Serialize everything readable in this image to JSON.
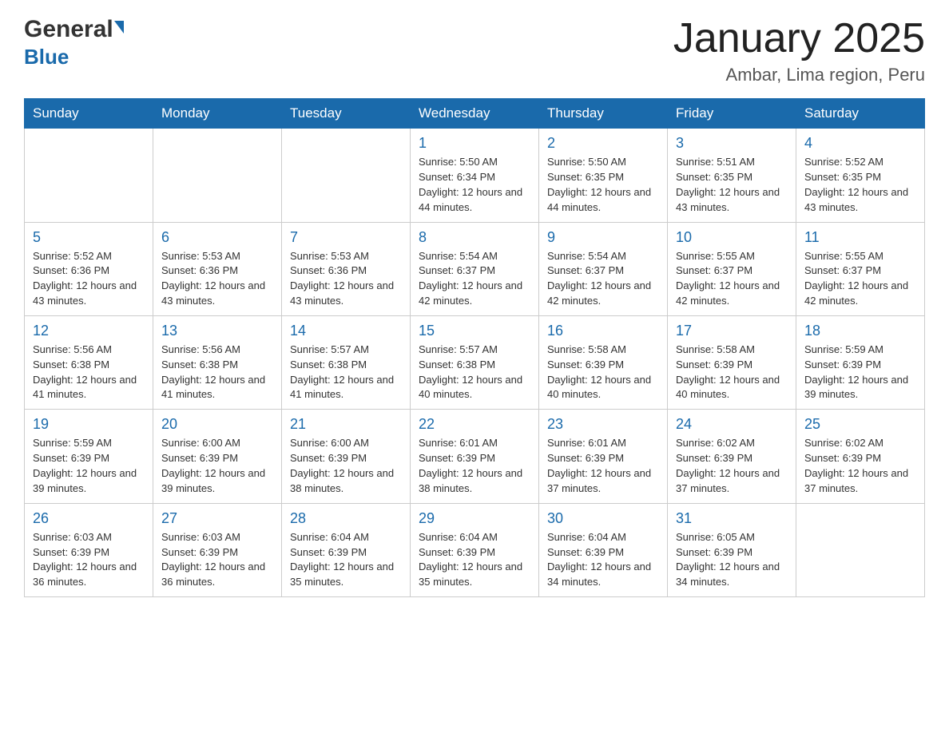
{
  "logo": {
    "general": "General",
    "blue": "Blue"
  },
  "header": {
    "title": "January 2025",
    "subtitle": "Ambar, Lima region, Peru"
  },
  "days": [
    "Sunday",
    "Monday",
    "Tuesday",
    "Wednesday",
    "Thursday",
    "Friday",
    "Saturday"
  ],
  "weeks": [
    [
      {
        "date": "",
        "info": ""
      },
      {
        "date": "",
        "info": ""
      },
      {
        "date": "",
        "info": ""
      },
      {
        "date": "1",
        "info": "Sunrise: 5:50 AM\nSunset: 6:34 PM\nDaylight: 12 hours and 44 minutes."
      },
      {
        "date": "2",
        "info": "Sunrise: 5:50 AM\nSunset: 6:35 PM\nDaylight: 12 hours and 44 minutes."
      },
      {
        "date": "3",
        "info": "Sunrise: 5:51 AM\nSunset: 6:35 PM\nDaylight: 12 hours and 43 minutes."
      },
      {
        "date": "4",
        "info": "Sunrise: 5:52 AM\nSunset: 6:35 PM\nDaylight: 12 hours and 43 minutes."
      }
    ],
    [
      {
        "date": "5",
        "info": "Sunrise: 5:52 AM\nSunset: 6:36 PM\nDaylight: 12 hours and 43 minutes."
      },
      {
        "date": "6",
        "info": "Sunrise: 5:53 AM\nSunset: 6:36 PM\nDaylight: 12 hours and 43 minutes."
      },
      {
        "date": "7",
        "info": "Sunrise: 5:53 AM\nSunset: 6:36 PM\nDaylight: 12 hours and 43 minutes."
      },
      {
        "date": "8",
        "info": "Sunrise: 5:54 AM\nSunset: 6:37 PM\nDaylight: 12 hours and 42 minutes."
      },
      {
        "date": "9",
        "info": "Sunrise: 5:54 AM\nSunset: 6:37 PM\nDaylight: 12 hours and 42 minutes."
      },
      {
        "date": "10",
        "info": "Sunrise: 5:55 AM\nSunset: 6:37 PM\nDaylight: 12 hours and 42 minutes."
      },
      {
        "date": "11",
        "info": "Sunrise: 5:55 AM\nSunset: 6:37 PM\nDaylight: 12 hours and 42 minutes."
      }
    ],
    [
      {
        "date": "12",
        "info": "Sunrise: 5:56 AM\nSunset: 6:38 PM\nDaylight: 12 hours and 41 minutes."
      },
      {
        "date": "13",
        "info": "Sunrise: 5:56 AM\nSunset: 6:38 PM\nDaylight: 12 hours and 41 minutes."
      },
      {
        "date": "14",
        "info": "Sunrise: 5:57 AM\nSunset: 6:38 PM\nDaylight: 12 hours and 41 minutes."
      },
      {
        "date": "15",
        "info": "Sunrise: 5:57 AM\nSunset: 6:38 PM\nDaylight: 12 hours and 40 minutes."
      },
      {
        "date": "16",
        "info": "Sunrise: 5:58 AM\nSunset: 6:39 PM\nDaylight: 12 hours and 40 minutes."
      },
      {
        "date": "17",
        "info": "Sunrise: 5:58 AM\nSunset: 6:39 PM\nDaylight: 12 hours and 40 minutes."
      },
      {
        "date": "18",
        "info": "Sunrise: 5:59 AM\nSunset: 6:39 PM\nDaylight: 12 hours and 39 minutes."
      }
    ],
    [
      {
        "date": "19",
        "info": "Sunrise: 5:59 AM\nSunset: 6:39 PM\nDaylight: 12 hours and 39 minutes."
      },
      {
        "date": "20",
        "info": "Sunrise: 6:00 AM\nSunset: 6:39 PM\nDaylight: 12 hours and 39 minutes."
      },
      {
        "date": "21",
        "info": "Sunrise: 6:00 AM\nSunset: 6:39 PM\nDaylight: 12 hours and 38 minutes."
      },
      {
        "date": "22",
        "info": "Sunrise: 6:01 AM\nSunset: 6:39 PM\nDaylight: 12 hours and 38 minutes."
      },
      {
        "date": "23",
        "info": "Sunrise: 6:01 AM\nSunset: 6:39 PM\nDaylight: 12 hours and 37 minutes."
      },
      {
        "date": "24",
        "info": "Sunrise: 6:02 AM\nSunset: 6:39 PM\nDaylight: 12 hours and 37 minutes."
      },
      {
        "date": "25",
        "info": "Sunrise: 6:02 AM\nSunset: 6:39 PM\nDaylight: 12 hours and 37 minutes."
      }
    ],
    [
      {
        "date": "26",
        "info": "Sunrise: 6:03 AM\nSunset: 6:39 PM\nDaylight: 12 hours and 36 minutes."
      },
      {
        "date": "27",
        "info": "Sunrise: 6:03 AM\nSunset: 6:39 PM\nDaylight: 12 hours and 36 minutes."
      },
      {
        "date": "28",
        "info": "Sunrise: 6:04 AM\nSunset: 6:39 PM\nDaylight: 12 hours and 35 minutes."
      },
      {
        "date": "29",
        "info": "Sunrise: 6:04 AM\nSunset: 6:39 PM\nDaylight: 12 hours and 35 minutes."
      },
      {
        "date": "30",
        "info": "Sunrise: 6:04 AM\nSunset: 6:39 PM\nDaylight: 12 hours and 34 minutes."
      },
      {
        "date": "31",
        "info": "Sunrise: 6:05 AM\nSunset: 6:39 PM\nDaylight: 12 hours and 34 minutes."
      },
      {
        "date": "",
        "info": ""
      }
    ]
  ]
}
